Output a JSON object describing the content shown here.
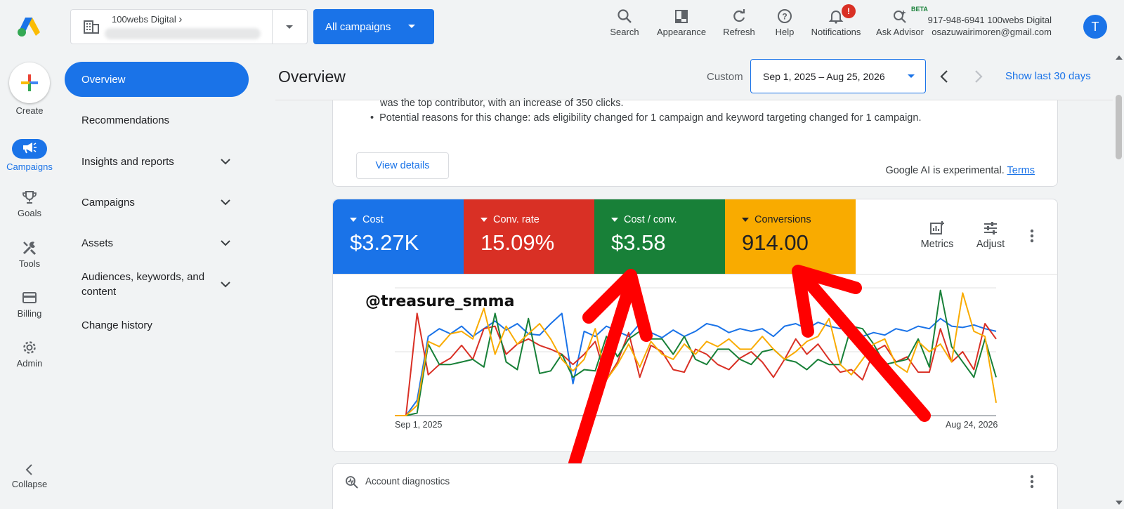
{
  "account": {
    "name": "100webs Digital"
  },
  "campaign_selector": {
    "label": "All campaigns"
  },
  "toolbar": [
    {
      "key": "search",
      "label": "Search"
    },
    {
      "key": "appearance",
      "label": "Appearance"
    },
    {
      "key": "refresh",
      "label": "Refresh"
    },
    {
      "key": "help",
      "label": "Help"
    },
    {
      "key": "notifications",
      "label": "Notifications",
      "badge": "!"
    },
    {
      "key": "ask_advisor",
      "label": "Ask Advisor",
      "tag": "BETA"
    }
  ],
  "user": {
    "line1": "917-948-6941 100webs Digital",
    "email": "osazuwairimoren@gmail.com",
    "avatar_letter": "T"
  },
  "rail": {
    "create": "Create",
    "campaigns": "Campaigns",
    "goals": "Goals",
    "tools": "Tools",
    "billing": "Billing",
    "admin": "Admin",
    "collapse": "Collapse"
  },
  "nav": [
    {
      "label": "Overview",
      "active": true
    },
    {
      "label": "Recommendations"
    },
    {
      "label": "Insights and reports",
      "expandable": true
    },
    {
      "label": "Campaigns",
      "expandable": true
    },
    {
      "label": "Assets",
      "expandable": true
    },
    {
      "label": "Audiences, keywords, and content",
      "expandable": true
    },
    {
      "label": "Change history"
    }
  ],
  "header": {
    "title": "Overview",
    "range_type": "Custom",
    "date_range": "Sep 1, 2025 – Aug 25, 2026",
    "show_last": "Show last 30 days"
  },
  "summary": {
    "line_partial": "was the top contributor, with an increase of 350 clicks.",
    "bullet": "Potential reasons for this change: ads eligibility changed for 1 campaign and keyword targeting changed for 1 campaign.",
    "view_details": "View details",
    "ai_note": "Google AI is experimental.",
    "terms": "Terms"
  },
  "metrics": [
    {
      "label": "Cost",
      "value": "$3.27K",
      "color": "#1a73e8"
    },
    {
      "label": "Conv. rate",
      "value": "15.09%",
      "color": "#d93025"
    },
    {
      "label": "Cost / conv.",
      "value": "$3.58",
      "color": "#188038"
    },
    {
      "label": "Conversions",
      "value": "914.00",
      "color": "#f9ab00"
    }
  ],
  "metric_tools": {
    "metrics": "Metrics",
    "adjust": "Adjust"
  },
  "overlay": {
    "watermark": "@treasure_smma",
    "arrow_color": "#ff0000"
  },
  "chart_data": {
    "type": "line",
    "x_start": "Sep 1, 2025",
    "x_end": "Aug 24, 2026",
    "grid": true,
    "ylim": [
      0,
      100
    ],
    "series": [
      {
        "color": "#1a73e8",
        "values": [
          0,
          0,
          12,
          62,
          68,
          64,
          70,
          62,
          68,
          74,
          67,
          72,
          64,
          63,
          72,
          80,
          25,
          66,
          62,
          70,
          66,
          62,
          72,
          65,
          61,
          67,
          62,
          66,
          72,
          70,
          65,
          68,
          66,
          68,
          62,
          70,
          72,
          68,
          73,
          70,
          68,
          71,
          62,
          65,
          63,
          68,
          66,
          70,
          68,
          76,
          70,
          69,
          71,
          68,
          66
        ]
      },
      {
        "color": "#d93025",
        "values": [
          0,
          0,
          80,
          32,
          40,
          45,
          55,
          44,
          68,
          70,
          48,
          56,
          60,
          55,
          52,
          48,
          40,
          48,
          58,
          28,
          42,
          65,
          30,
          55,
          50,
          36,
          34,
          52,
          48,
          40,
          36,
          45,
          50,
          42,
          30,
          44,
          60,
          48,
          56,
          44,
          34,
          36,
          28,
          50,
          55,
          42,
          46,
          34,
          34,
          68,
          42,
          50,
          36,
          72,
          60
        ]
      },
      {
        "color": "#188038",
        "values": [
          0,
          0,
          2,
          56,
          40,
          40,
          42,
          44,
          38,
          80,
          42,
          36,
          76,
          33,
          35,
          48,
          30,
          36,
          35,
          62,
          46,
          60,
          66,
          60,
          60,
          48,
          62,
          44,
          40,
          52,
          52,
          44,
          40,
          50,
          52,
          44,
          42,
          36,
          44,
          40,
          40,
          70,
          68,
          56,
          40,
          42,
          44,
          60,
          38,
          98,
          54,
          42,
          30,
          60,
          30
        ]
      },
      {
        "color": "#f9ab00",
        "values": [
          0,
          0,
          8,
          58,
          54,
          64,
          66,
          60,
          84,
          48,
          70,
          56,
          64,
          72,
          60,
          44,
          35,
          44,
          68,
          28,
          40,
          56,
          38,
          58,
          48,
          44,
          56,
          48,
          58,
          54,
          60,
          52,
          52,
          62,
          52,
          44,
          50,
          58,
          62,
          76,
          40,
          32,
          44,
          56,
          60,
          40,
          34,
          58,
          50,
          56,
          42,
          96,
          66,
          62,
          10
        ]
      }
    ]
  },
  "diagnostics": {
    "title": "Account diagnostics"
  }
}
